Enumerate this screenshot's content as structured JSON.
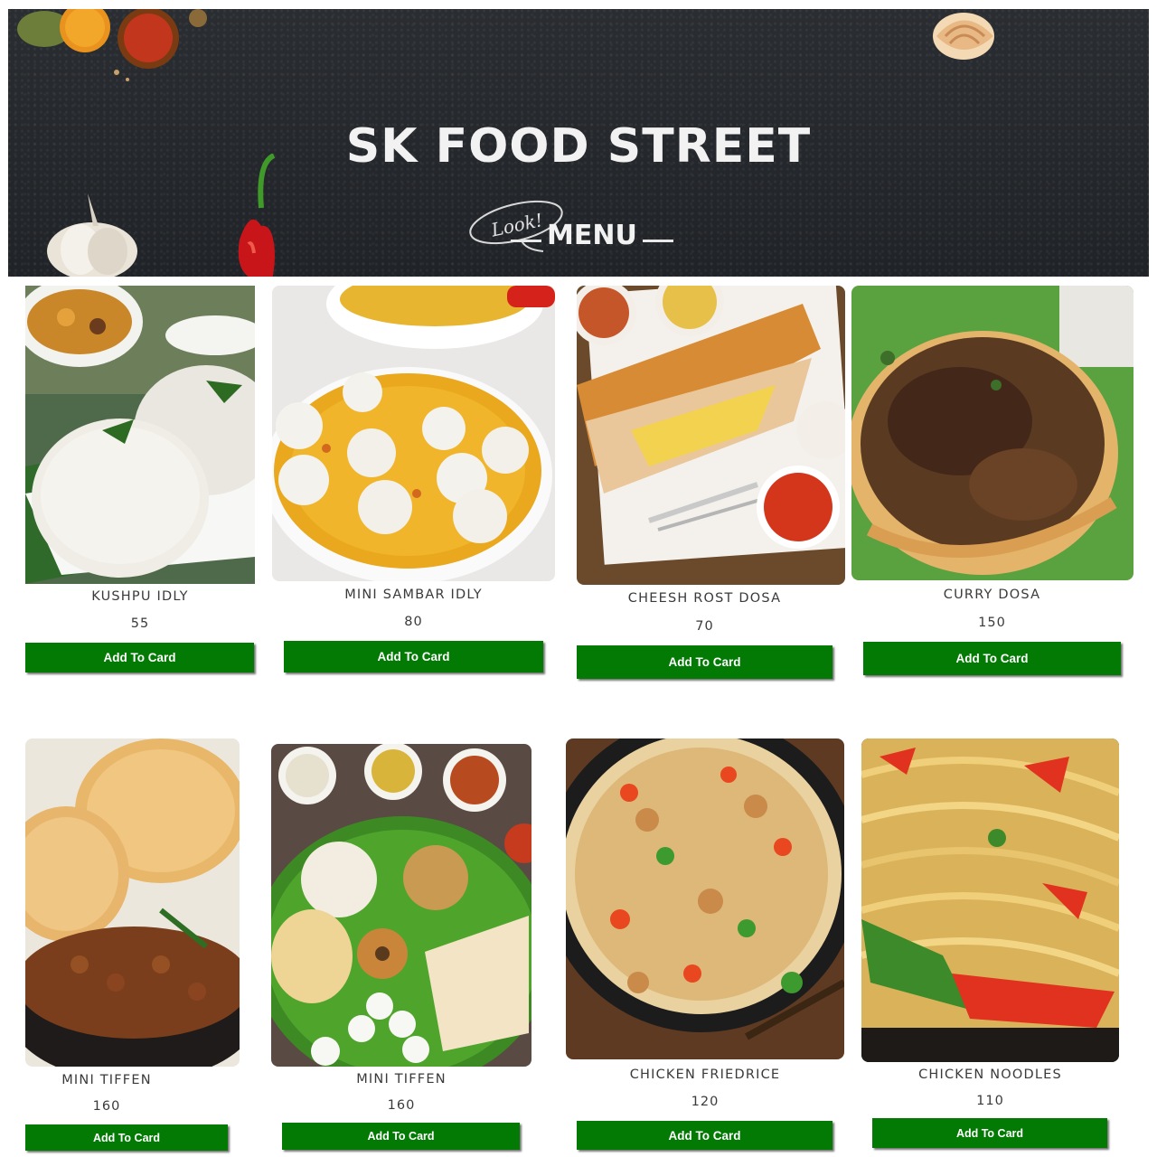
{
  "header": {
    "title": "SK FOOD STREET",
    "look_text": "Look!",
    "menu_label": "MENU"
  },
  "button_label": "Add To Card",
  "items": [
    {
      "name": "KUSHPU IDLY",
      "price": "55",
      "image": "idly-plate"
    },
    {
      "name": "MINI SAMBAR IDLY",
      "price": "80",
      "image": "sambar-idly-bowl"
    },
    {
      "name": "CHEESH ROST DOSA",
      "price": "70",
      "image": "dosa-plate"
    },
    {
      "name": "CURRY DOSA",
      "price": "150",
      "image": "curry-dosa"
    },
    {
      "name": "MINI TIFFEN",
      "price": "160",
      "image": "puri-chana"
    },
    {
      "name": "MINI TIFFEN",
      "price": "160",
      "image": "tiffin-thali"
    },
    {
      "name": "CHICKEN FRIEDRICE",
      "price": "120",
      "image": "fried-rice-pan"
    },
    {
      "name": "CHICKEN NOODLES",
      "price": "110",
      "image": "noodles-pan"
    }
  ],
  "colors": {
    "button_bg": "#037a04",
    "banner_bg": "#24272b",
    "text": "#3a3a3a"
  }
}
